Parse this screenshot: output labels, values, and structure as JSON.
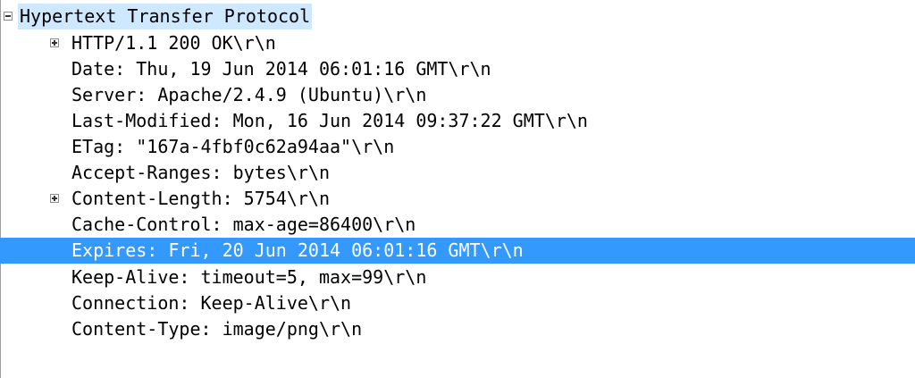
{
  "tree": {
    "root_label": "Hypertext Transfer Protocol",
    "items": [
      {
        "label": "HTTP/1.1 200 OK\\r\\n",
        "expandable": true
      },
      {
        "label": "Date: Thu, 19 Jun 2014 06:01:16 GMT\\r\\n",
        "expandable": false
      },
      {
        "label": "Server: Apache/2.4.9 (Ubuntu)\\r\\n",
        "expandable": false
      },
      {
        "label": "Last-Modified: Mon, 16 Jun 2014 09:37:22 GMT\\r\\n",
        "expandable": false
      },
      {
        "label": "ETag: \"167a-4fbf0c62a94aa\"\\r\\n",
        "expandable": false
      },
      {
        "label": "Accept-Ranges: bytes\\r\\n",
        "expandable": false
      },
      {
        "label": "Content-Length: 5754\\r\\n",
        "expandable": true
      },
      {
        "label": "Cache-Control: max-age=86400\\r\\n",
        "expandable": false
      },
      {
        "label": "Expires: Fri, 20 Jun 2014 06:01:16 GMT\\r\\n",
        "expandable": false,
        "selected": true
      },
      {
        "label": "Keep-Alive: timeout=5, max=99\\r\\n",
        "expandable": false
      },
      {
        "label": "Connection: Keep-Alive\\r\\n",
        "expandable": false
      },
      {
        "label": "Content-Type: image/png\\r\\n",
        "expandable": false
      }
    ]
  },
  "colors": {
    "selection": "#3399ff",
    "root_highlight": "#cde8ff"
  }
}
